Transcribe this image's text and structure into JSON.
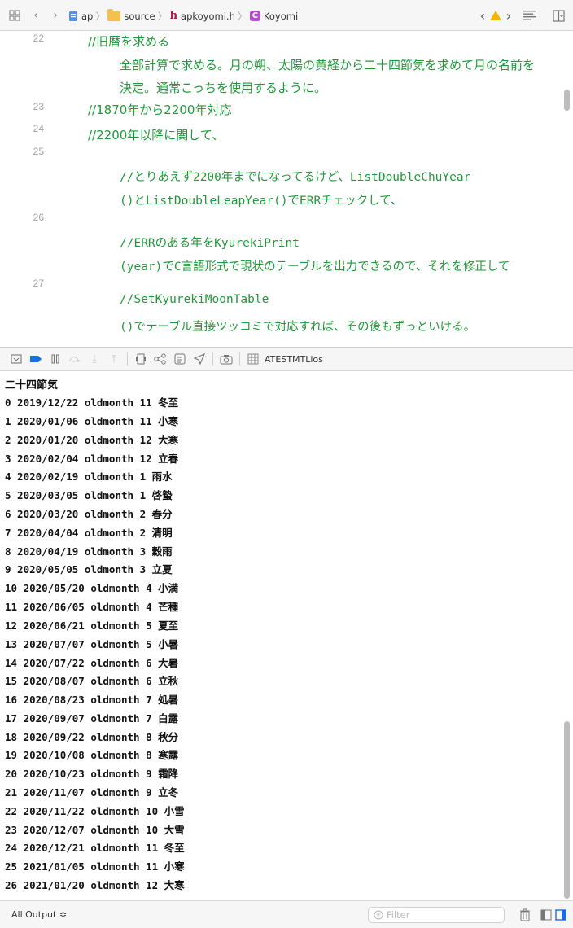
{
  "jump_bar": {
    "crumbs": [
      "ap",
      "source",
      "apkoyomi.h",
      "Koyomi"
    ]
  },
  "editor": {
    "lines": [
      {
        "num": "22",
        "segments": [
          "//旧暦を求める",
          "全部計算で求める。月の朔、太陽の黄経から二十四節気を求めて月の名前を",
          "決定。通常こっちを使用するように。"
        ]
      },
      {
        "num": "23",
        "segments": [
          "//1870年から2200年対応"
        ]
      },
      {
        "num": "24",
        "segments": [
          "//2200年以降に関して、"
        ]
      },
      {
        "num": "25",
        "segments": [
          "//とりあえず2200年までになってるけど、ListDoubleChuYear",
          "()とListDoubleLeapYear()でERRチェックして、"
        ]
      },
      {
        "num": "26",
        "segments": [
          "//ERRのある年をKyurekiPrint",
          "(year)でC言語形式で現状のテーブルを出力できるので、それを修正して"
        ]
      },
      {
        "num": "27",
        "segments": [
          "//SetKyurekiMoonTable",
          "()でテーブル直接ツッコミで対応すれば、その後もずっといける。"
        ]
      }
    ]
  },
  "debug_bar": {
    "target_label": "ATESTMTLios"
  },
  "console": {
    "header": "二十四節気",
    "lines": [
      "0  2019/12/22 oldmonth 11 冬至",
      "1  2020/01/06 oldmonth 11 小寒",
      "2  2020/01/20 oldmonth 12 大寒",
      "3  2020/02/04 oldmonth 12 立春",
      "4  2020/02/19 oldmonth 1 雨水",
      "5  2020/03/05 oldmonth 1 啓蟄",
      "6  2020/03/20 oldmonth 2 春分",
      "7  2020/04/04 oldmonth 2 清明",
      "8  2020/04/19 oldmonth 3 穀雨",
      "9  2020/05/05 oldmonth 3 立夏",
      "10  2020/05/20 oldmonth 4 小満",
      "11  2020/06/05 oldmonth 4 芒種",
      "12  2020/06/21 oldmonth 5 夏至",
      "13  2020/07/07 oldmonth 5 小暑",
      "14  2020/07/22 oldmonth 6 大暑",
      "15  2020/08/07 oldmonth 6 立秋",
      "16  2020/08/23 oldmonth 7 処暑",
      "17  2020/09/07 oldmonth 7 白露",
      "18  2020/09/22 oldmonth 8 秋分",
      "19  2020/10/08 oldmonth 8 寒露",
      "20  2020/10/23 oldmonth 9 霜降",
      "21  2020/11/07 oldmonth 9 立冬",
      "22  2020/11/22 oldmonth 10 小雪",
      "23  2020/12/07 oldmonth 10 大雪",
      "24  2020/12/21 oldmonth 11 冬至",
      "25  2021/01/05 oldmonth 11 小寒",
      "26  2021/01/20 oldmonth 12 大寒"
    ]
  },
  "status_bar": {
    "output_selector": "All Output ≎",
    "filter_placeholder": "Filter"
  },
  "colors": {
    "comment_green": "#1f9a3a",
    "accent_blue": "#1a6fe0",
    "warning_yellow": "#f3b400"
  },
  "icons": [
    "grid-icon",
    "back-arrow-icon",
    "forward-arrow-icon",
    "folder-icon",
    "header-file-icon",
    "class-icon",
    "warning-icon",
    "editor-options-icon",
    "add-editor-icon",
    "hide-debug-icon",
    "breakpoint-icon",
    "pause-icon",
    "step-over-icon",
    "step-into-icon",
    "step-out-icon",
    "view-hierarchy-icon",
    "memory-graph-icon",
    "environment-icon",
    "location-icon",
    "camera-icon",
    "target-icon",
    "filter-icon",
    "trash-icon",
    "left-panel-icon",
    "right-panel-icon"
  ]
}
